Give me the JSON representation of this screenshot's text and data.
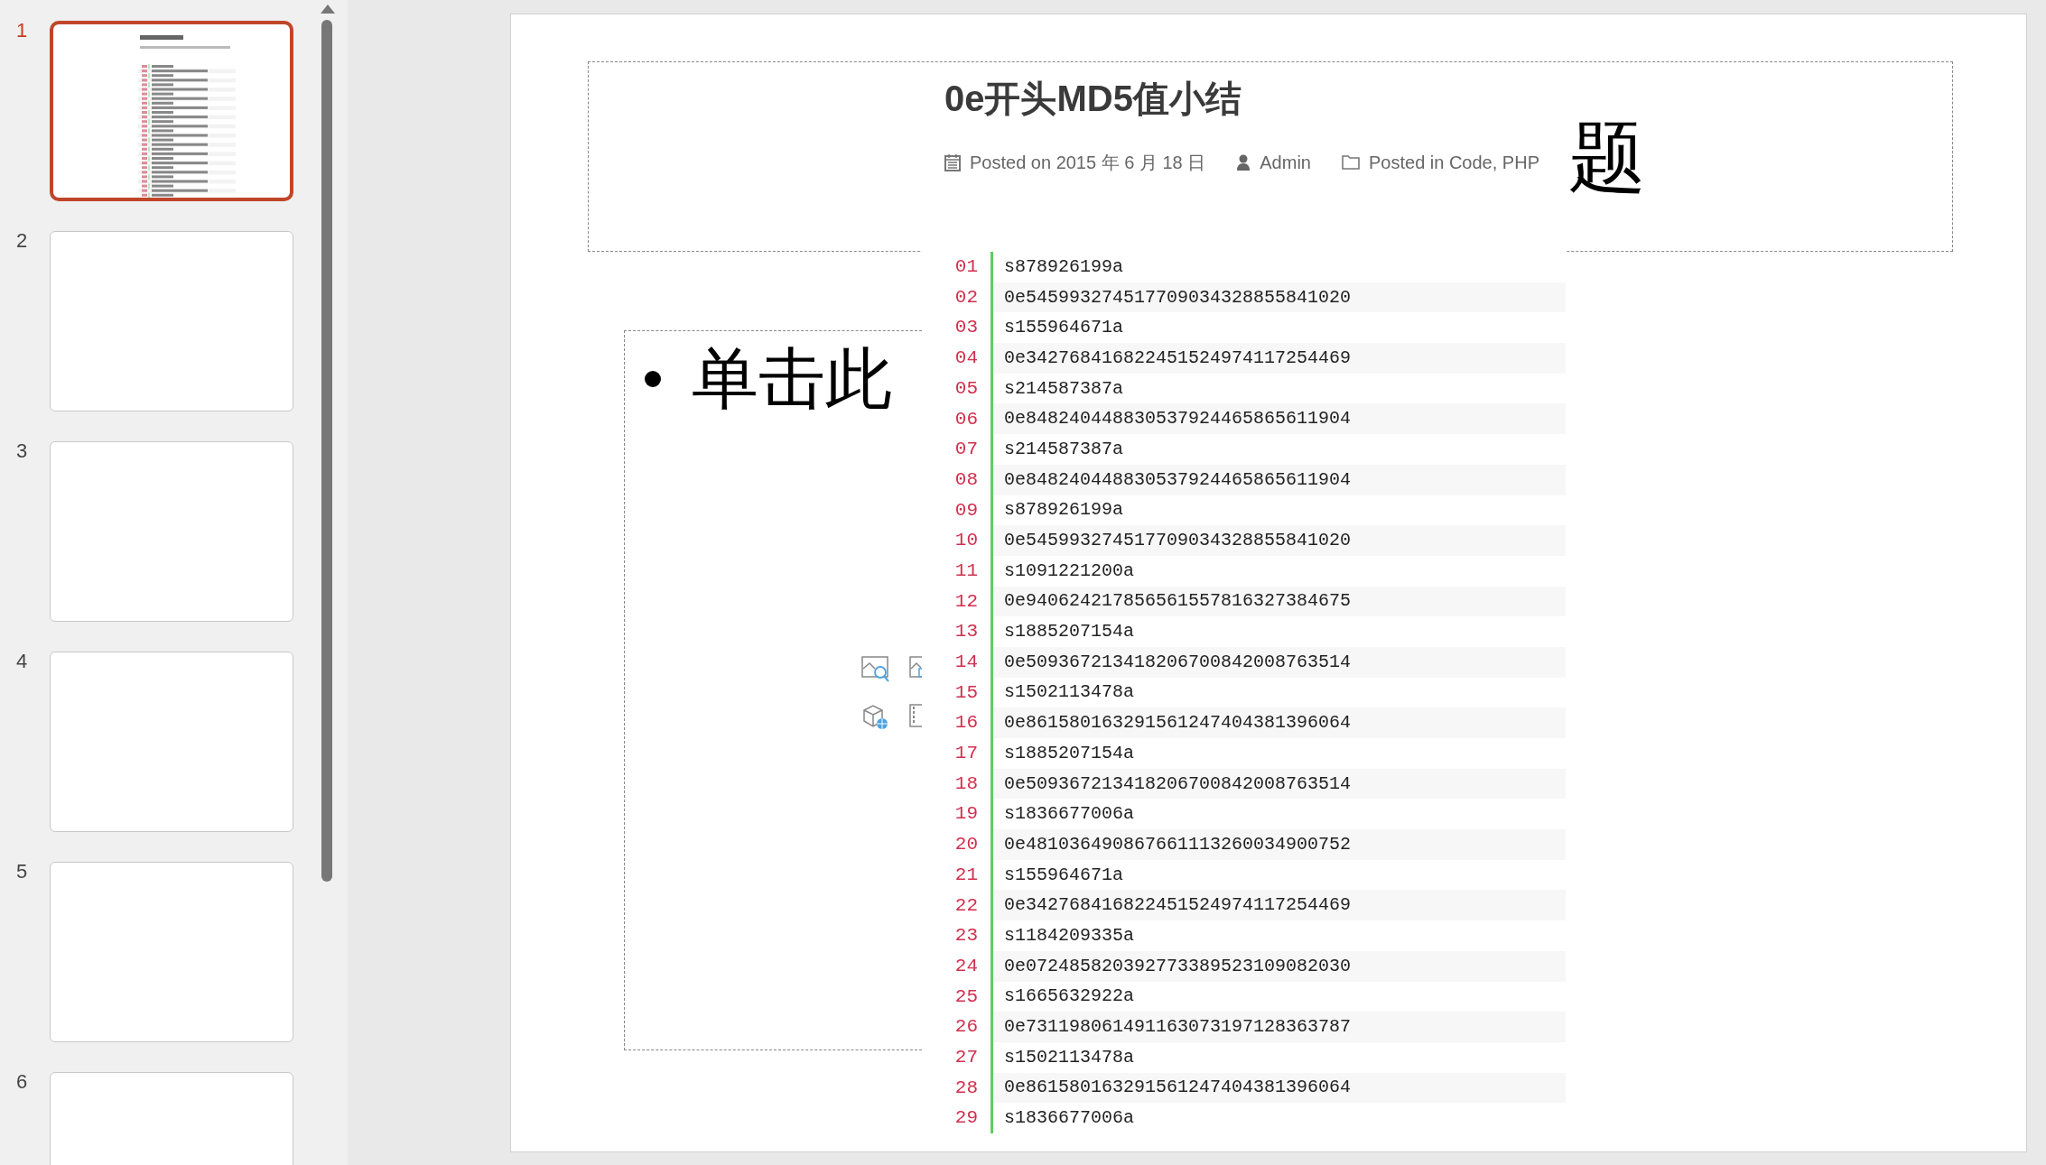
{
  "slides_pane": {
    "slides": [
      {
        "number": "1",
        "selected": true,
        "has_content": true
      },
      {
        "number": "2",
        "selected": false,
        "has_content": false
      },
      {
        "number": "3",
        "selected": false,
        "has_content": false
      },
      {
        "number": "4",
        "selected": false,
        "has_content": false
      },
      {
        "number": "5",
        "selected": false,
        "has_content": false
      },
      {
        "number": "6",
        "selected": false,
        "has_content": false
      }
    ]
  },
  "slide": {
    "title_placeholder": {
      "text": "题"
    },
    "content_placeholder": {
      "bullet_text": "单击此"
    },
    "pasted_image": {
      "title": "0e开头MD5值小结",
      "meta": {
        "date": "Posted on 2015 年 6 月 18 日",
        "author": "Admin",
        "categories": "Posted in Code, PHP"
      },
      "code_lines": [
        {
          "number": "01",
          "code": "s878926199a"
        },
        {
          "number": "02",
          "code": "0e545993274517709034328855841020"
        },
        {
          "number": "03",
          "code": "s155964671a"
        },
        {
          "number": "04",
          "code": "0e342768416822451524974117254469"
        },
        {
          "number": "05",
          "code": "s214587387a"
        },
        {
          "number": "06",
          "code": "0e848240448830537924465865611904"
        },
        {
          "number": "07",
          "code": "s214587387a"
        },
        {
          "number": "08",
          "code": "0e848240448830537924465865611904"
        },
        {
          "number": "09",
          "code": "s878926199a"
        },
        {
          "number": "10",
          "code": "0e545993274517709034328855841020"
        },
        {
          "number": "11",
          "code": "s1091221200a"
        },
        {
          "number": "12",
          "code": "0e940624217856561557816327384675"
        },
        {
          "number": "13",
          "code": "s1885207154a"
        },
        {
          "number": "14",
          "code": "0e509367213418206700842008763514"
        },
        {
          "number": "15",
          "code": "s1502113478a"
        },
        {
          "number": "16",
          "code": "0e861580163291561247404381396064"
        },
        {
          "number": "17",
          "code": "s1885207154a"
        },
        {
          "number": "18",
          "code": "0e509367213418206700842008763514"
        },
        {
          "number": "19",
          "code": "s1836677006a"
        },
        {
          "number": "20",
          "code": "0e481036490867661113260034900752"
        },
        {
          "number": "21",
          "code": "s155964671a"
        },
        {
          "number": "22",
          "code": "0e342768416822451524974117254469"
        },
        {
          "number": "23",
          "code": "s1184209335a"
        },
        {
          "number": "24",
          "code": "0e072485820392773389523109082030"
        },
        {
          "number": "25",
          "code": "s1665632922a"
        },
        {
          "number": "26",
          "code": "0e731198061491163073197128363787"
        },
        {
          "number": "27",
          "code": "s1502113478a"
        },
        {
          "number": "28",
          "code": "0e861580163291561247404381396064"
        },
        {
          "number": "29",
          "code": "s1836677006a"
        }
      ]
    }
  }
}
